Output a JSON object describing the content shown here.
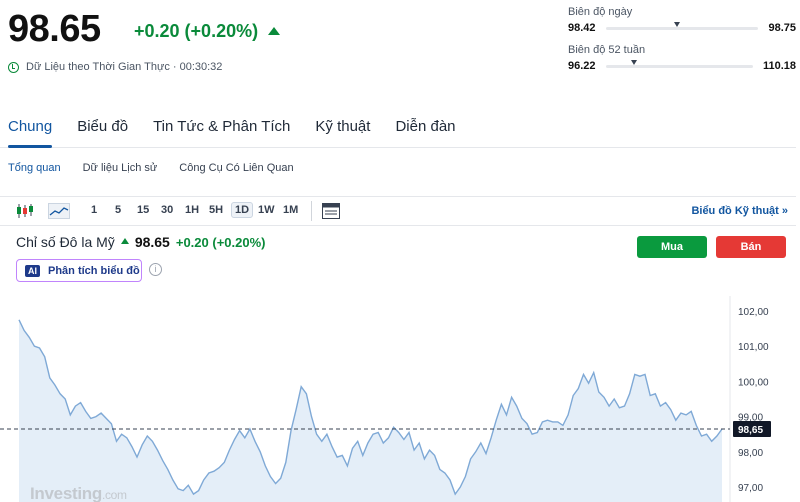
{
  "quote": {
    "price": "98.65",
    "change": "+0.20 (+0.20%)",
    "realtime_label": "Dữ Liệu theo Thời Gian Thực · 00:30:32"
  },
  "day_range": {
    "label": "Biên độ ngày",
    "low": "98.42",
    "high": "98.75",
    "position": 0.45
  },
  "range_52w": {
    "label": "Biên độ 52 tuần",
    "low": "96.22",
    "high": "110.18",
    "position": 0.17
  },
  "tabs": [
    {
      "label": "Chung",
      "active": true
    },
    {
      "label": "Biểu đồ"
    },
    {
      "label": "Tin Tức & Phân Tích"
    },
    {
      "label": "Kỹ thuật"
    },
    {
      "label": "Diễn đàn"
    }
  ],
  "subtabs": [
    {
      "label": "Tổng quan",
      "active": true
    },
    {
      "label": "Dữ liệu Lịch sử"
    },
    {
      "label": "Công Cụ Có Liên Quan"
    }
  ],
  "toolbar": {
    "timeframes": [
      "1",
      "5",
      "15",
      "30",
      "1H",
      "5H",
      "1D",
      "1W",
      "1M"
    ],
    "active_timeframe": "1D",
    "tech_chart_link": "Biểu đồ Kỹ thuật »"
  },
  "instrument": {
    "name": "Chỉ số Đô la Mỹ",
    "price": "98.65",
    "change": "+0.20 (+0.20%)"
  },
  "ai_button": {
    "badge": "AI",
    "label": "Phân tích biểu đồ"
  },
  "actions": {
    "buy": "Mua",
    "sell": "Bán"
  },
  "watermark": {
    "brand": "Investing",
    "suffix": ".com"
  },
  "colors": {
    "accent": "#1256a0",
    "up": "#0a8a3a",
    "buy": "#0a9a3e",
    "sell": "#e53935",
    "line": "#7fa9d6",
    "area": "#e4eef8"
  },
  "chart_data": {
    "type": "area",
    "ylim": [
      96.5,
      102.5
    ],
    "y_ticks": [
      "102,00",
      "101,00",
      "100,00",
      "99,00",
      "98,00",
      "97,00"
    ],
    "y_tick_values": [
      102,
      101,
      100,
      99,
      98,
      97
    ],
    "last_value_label": "98,65",
    "last_value": 98.65,
    "values": [
      101.75,
      101.45,
      101.25,
      101.0,
      100.95,
      100.7,
      100.1,
      99.9,
      99.65,
      99.5,
      99.05,
      99.3,
      99.4,
      99.15,
      98.95,
      99.0,
      99.1,
      98.95,
      98.8,
      98.3,
      98.5,
      98.4,
      98.15,
      97.85,
      98.2,
      98.45,
      98.3,
      98.05,
      97.75,
      97.5,
      97.2,
      96.95,
      96.9,
      97.05,
      96.8,
      96.9,
      97.2,
      97.4,
      97.45,
      97.55,
      97.7,
      98.05,
      98.35,
      98.6,
      98.4,
      98.65,
      98.3,
      98.0,
      97.6,
      97.3,
      97.1,
      97.25,
      97.7,
      98.6,
      99.2,
      99.85,
      99.65,
      99.0,
      98.5,
      98.3,
      98.5,
      98.15,
      97.85,
      97.9,
      97.6,
      98.1,
      98.3,
      97.9,
      98.25,
      98.5,
      98.55,
      98.25,
      98.4,
      98.7,
      98.55,
      98.35,
      98.55,
      98.05,
      98.25,
      97.8,
      98.05,
      97.9,
      97.5,
      97.4,
      97.2,
      96.8,
      97.0,
      97.3,
      97.8,
      98.0,
      98.25,
      97.95,
      98.4,
      98.9,
      99.35,
      99.05,
      99.55,
      99.3,
      98.95,
      98.8,
      98.5,
      98.55,
      98.85,
      98.9,
      98.85,
      98.85,
      98.75,
      99.05,
      99.6,
      99.8,
      100.2,
      99.95,
      100.25,
      99.7,
      99.55,
      99.3,
      99.5,
      99.25,
      99.3,
      99.65,
      100.2,
      100.15,
      100.2,
      99.6,
      99.65,
      99.3,
      99.4,
      99.2,
      98.9,
      99.1,
      99.05,
      99.15,
      98.75,
      98.45,
      98.5,
      98.3,
      98.45,
      98.65
    ]
  }
}
